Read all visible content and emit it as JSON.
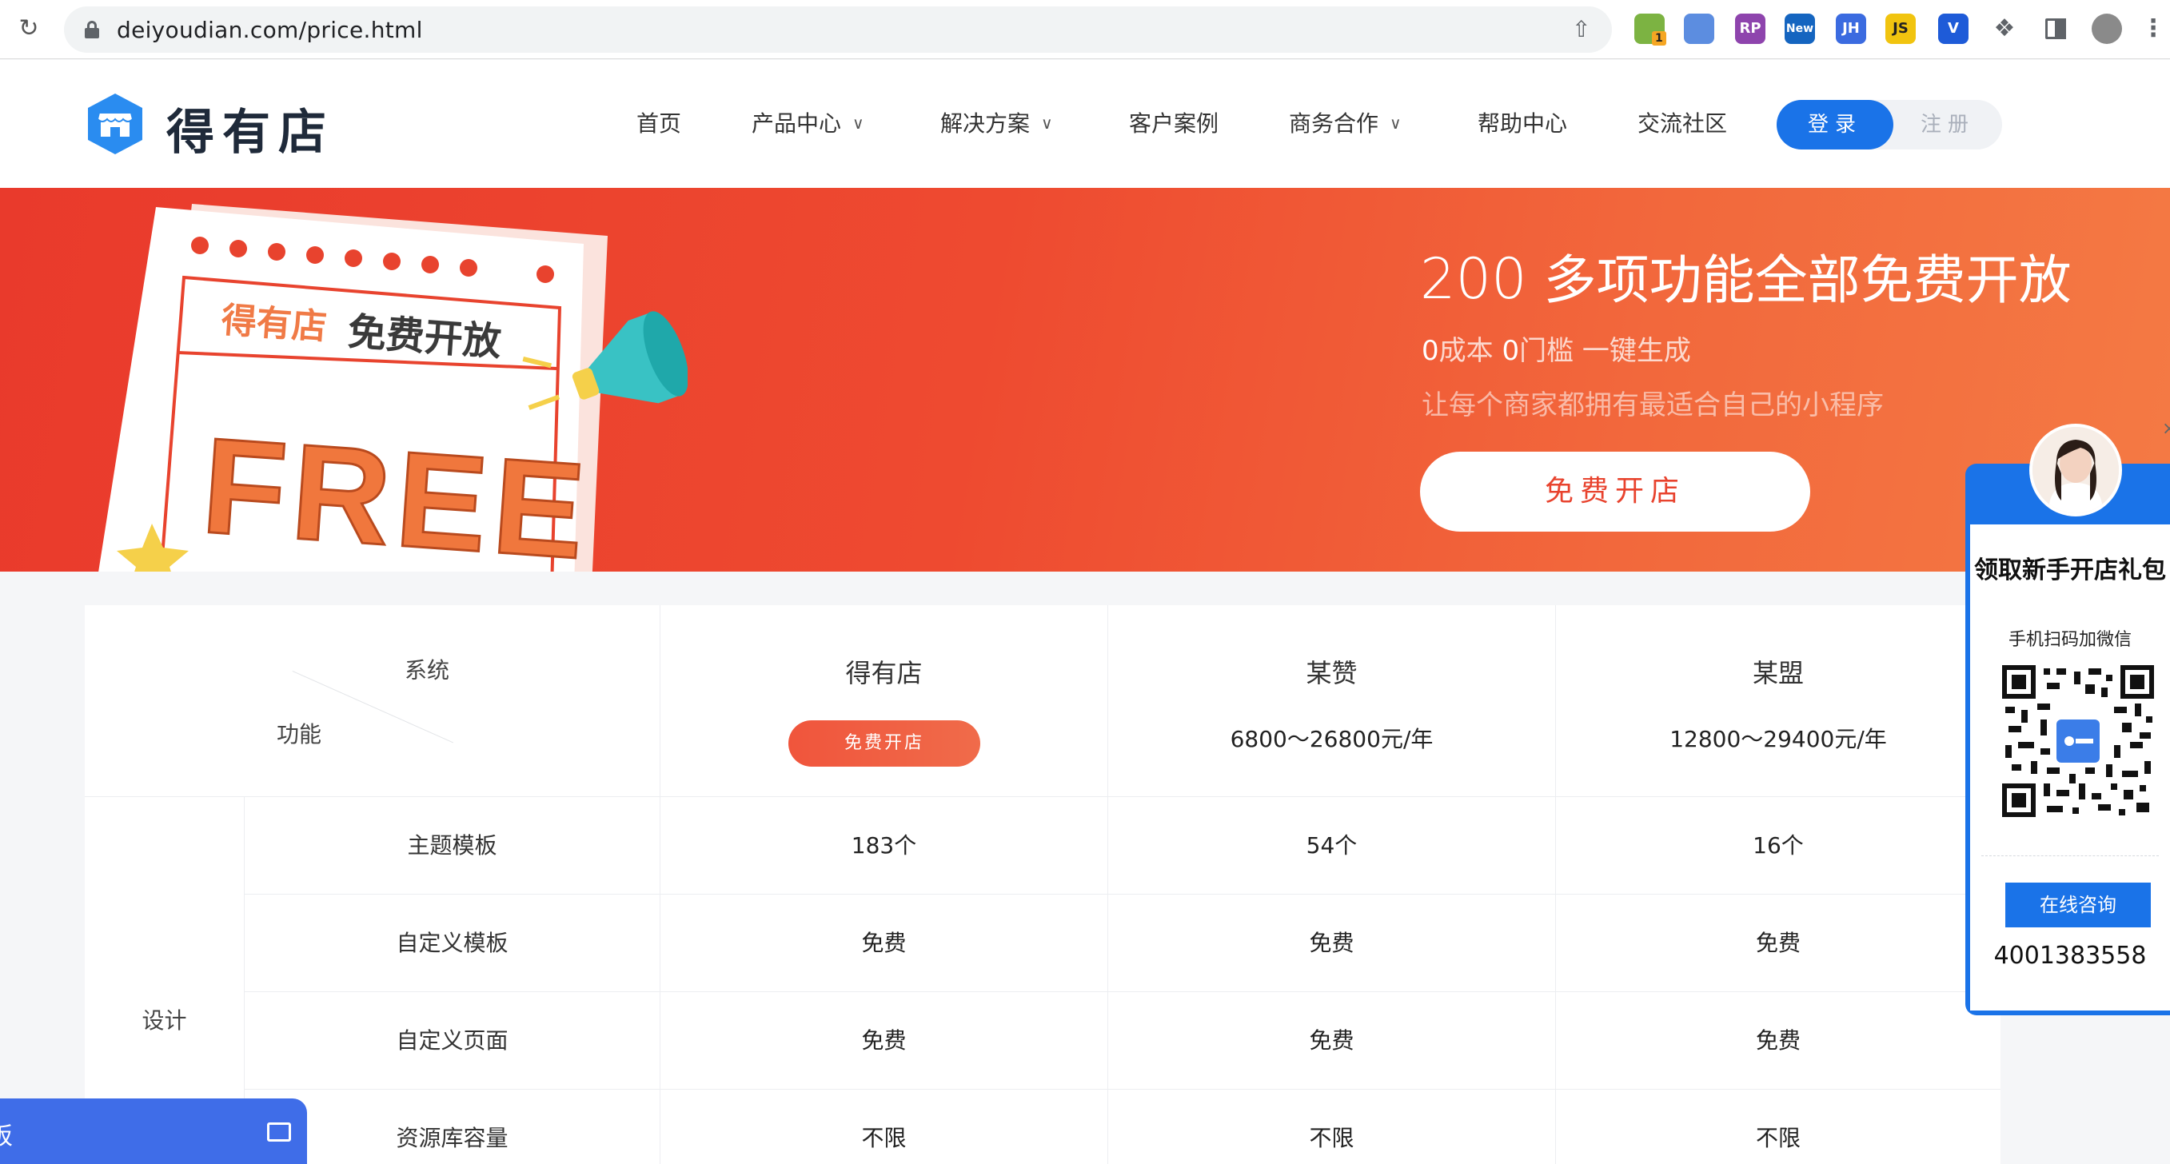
{
  "browser": {
    "url": "deiyoudian.com/price.html",
    "extensions": [
      {
        "name": "chrome-ext-1",
        "label": "",
        "color": "#7cb342",
        "badge": "1"
      },
      {
        "name": "chrome-ext-2",
        "label": "",
        "color": "#5c8de0"
      },
      {
        "name": "chrome-ext-rp",
        "label": "RP",
        "color": "#8e44ad"
      },
      {
        "name": "chrome-ext-new",
        "label": "New",
        "color": "#1565c0"
      },
      {
        "name": "chrome-ext-jh",
        "label": "JH",
        "color": "#3b6be0"
      },
      {
        "name": "chrome-ext-js",
        "label": "JS",
        "color": "#f1c40f"
      },
      {
        "name": "chrome-ext-v",
        "label": "V",
        "color": "#1e5bd8"
      }
    ]
  },
  "site": {
    "logo_text": "得有店",
    "nav": [
      {
        "label": "首页",
        "dropdown": false
      },
      {
        "label": "产品中心",
        "dropdown": true
      },
      {
        "label": "解决方案",
        "dropdown": true
      },
      {
        "label": "客户案例",
        "dropdown": false
      },
      {
        "label": "商务合作",
        "dropdown": true
      },
      {
        "label": "帮助中心",
        "dropdown": false
      },
      {
        "label": "交流社区",
        "dropdown": false
      }
    ],
    "login": "登录",
    "register": "注册"
  },
  "banner": {
    "art": {
      "brand": "得有店",
      "slogan": "免费开放",
      "big": "FREE"
    },
    "title_num": "200",
    "title_text": " 多项功能全部免费开放",
    "sub1": {
      "n1": "0",
      "t1": "成本 ",
      "n2": "0",
      "t2": "门槛 一键生成"
    },
    "sub2": "让每个商家都拥有最适合自己的小程序",
    "cta": "免费开店",
    "colors": {
      "start": "#e93a2c",
      "end": "#f47a44"
    }
  },
  "table": {
    "corner": {
      "system": "系统",
      "function": "功能"
    },
    "columns": [
      {
        "name": "得有店",
        "cta": "免费开店"
      },
      {
        "name": "某赞",
        "price": "6800～26800元/年"
      },
      {
        "name": "某盟",
        "price": "12800～29400元/年"
      }
    ],
    "category": "设计",
    "rows": [
      {
        "feature": "主题模板",
        "values": [
          "183个",
          "54个",
          "16个"
        ]
      },
      {
        "feature": "自定义模板",
        "values": [
          "免费",
          "免费",
          "免费"
        ]
      },
      {
        "feature": "自定义页面",
        "values": [
          "免费",
          "免费",
          "免费"
        ]
      },
      {
        "feature": "资源库容量",
        "values": [
          "不限",
          "不限",
          "不限"
        ]
      }
    ]
  },
  "float_widget": {
    "title": "领取新手开店礼包",
    "subtitle": "手机扫码加微信",
    "consult": "在线咨询",
    "phone": "4001383558",
    "close": "×"
  },
  "bottom_widget": {
    "label": "板"
  }
}
